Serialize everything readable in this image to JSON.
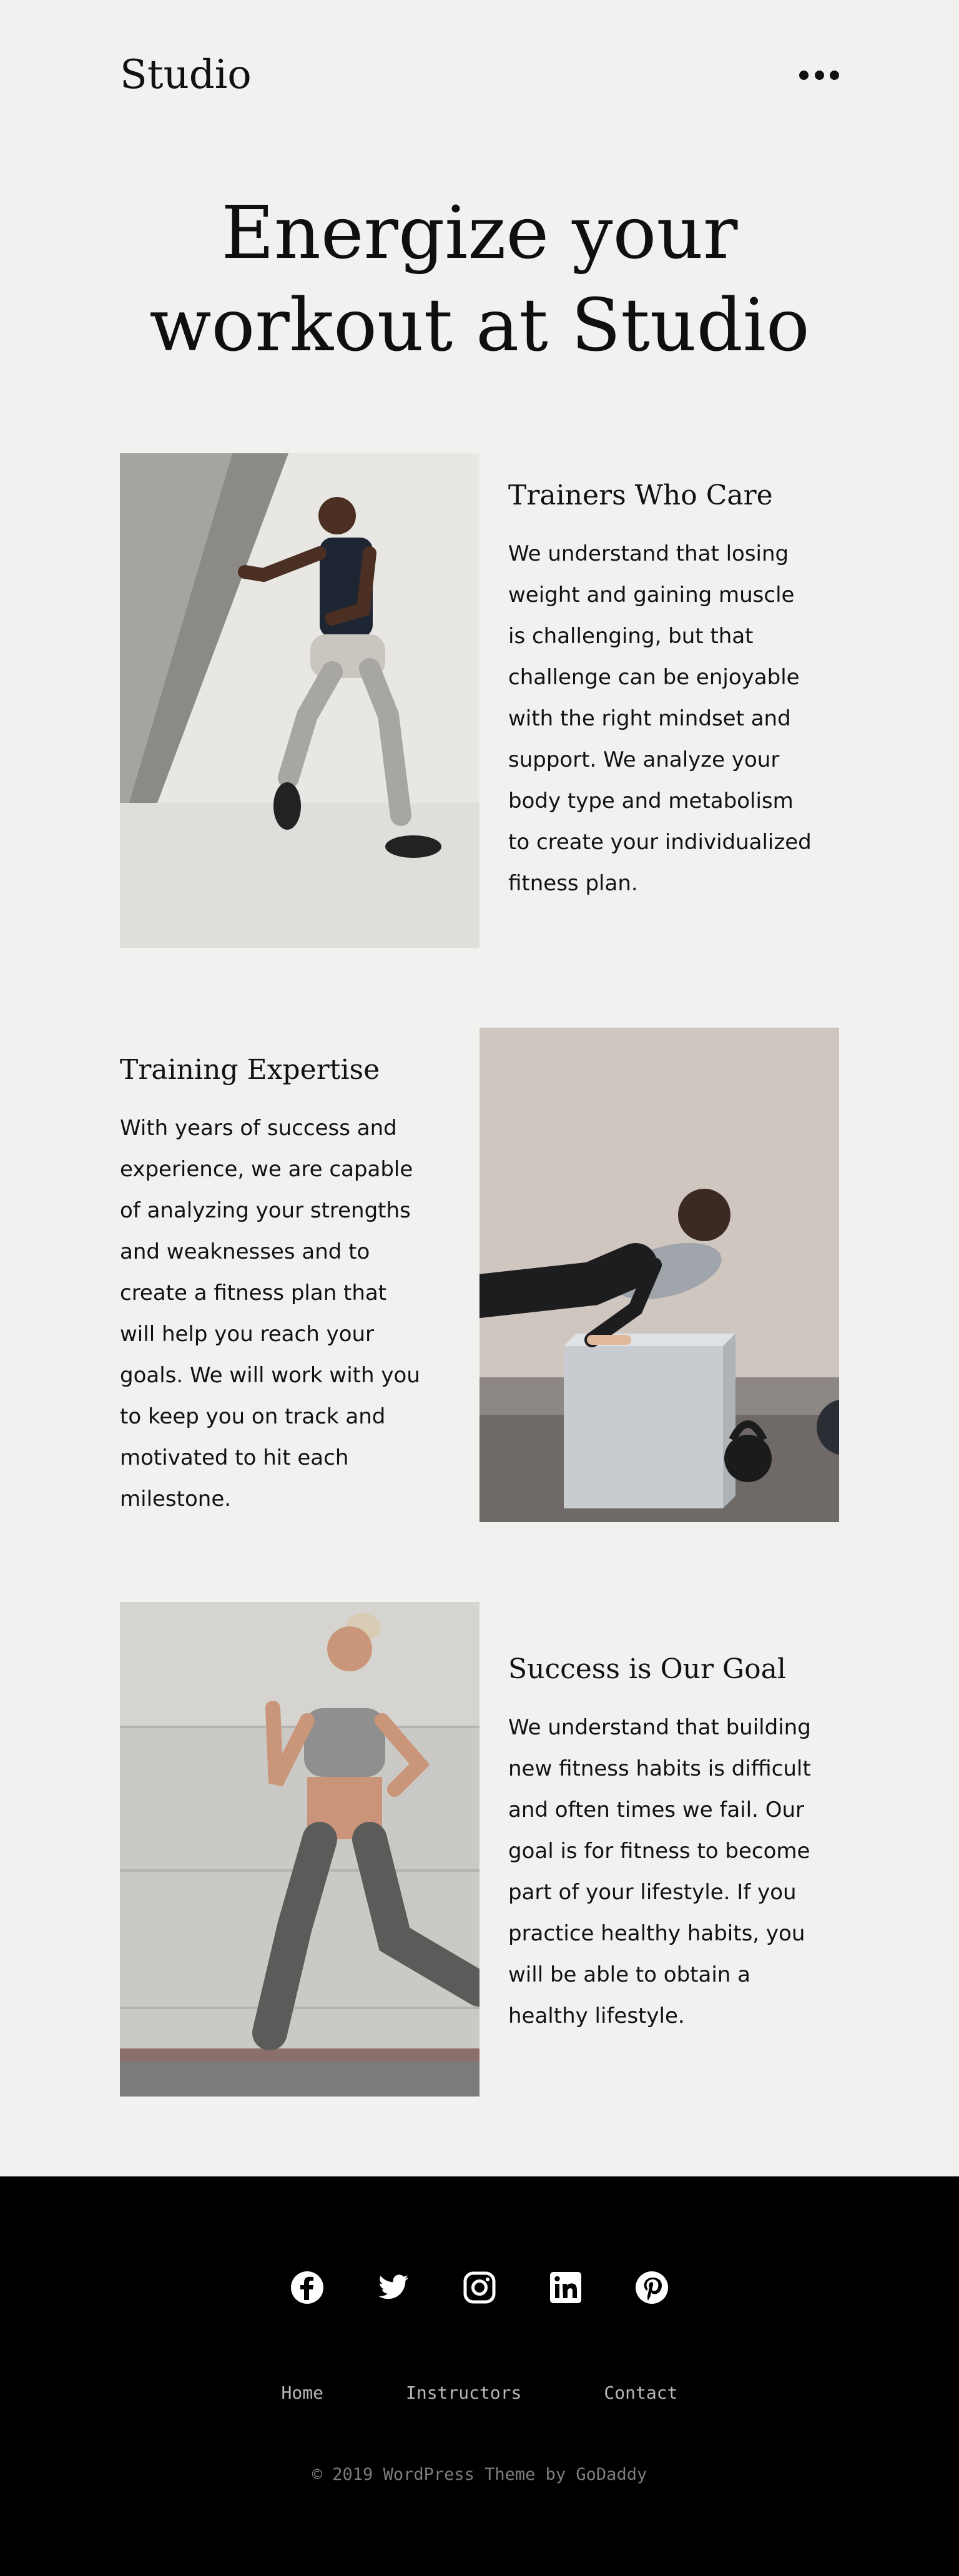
{
  "header": {
    "logo": "Studio",
    "menu_icon": "ellipsis-menu-icon"
  },
  "hero": {
    "title_line1": "Energize your",
    "title_line2": "workout at Studio"
  },
  "sections": [
    {
      "title": "Trainers Who Care",
      "body": "We understand that losing weight and gaining muscle is challenging, but that challenge can be enjoyable with the right mindset and support. We analyze your body type and metabolism to create your individualized fitness plan.",
      "image": "man-jumping-photo"
    },
    {
      "title": "Training Expertise",
      "body": "With years of success and experience, we are capable of analyzing your strengths and weaknesses and to create a fitness plan that will help you reach your goals. We will work with you to keep you on track and motivated to hit each milestone.",
      "image": "woman-box-pushup-photo"
    },
    {
      "title": "Success is Our Goal",
      "body": "We understand that building new fitness habits is difficult and often times we fail. Our goal is for fitness to become part of your lifestyle. If you practice healthy habits, you will be able to obtain a healthy lifestyle.",
      "image": "woman-running-photo"
    }
  ],
  "footer": {
    "social": [
      "facebook-icon",
      "twitter-icon",
      "instagram-icon",
      "linkedin-icon",
      "pinterest-icon"
    ],
    "nav": [
      "Home",
      "Instructors",
      "Contact"
    ],
    "copyright": "© 2019  WordPress Theme by GoDaddy"
  },
  "colors": {
    "background": "#f1f1ef",
    "footer": "#000000",
    "text": "#111111",
    "footer_link": "#b8b8b8"
  }
}
